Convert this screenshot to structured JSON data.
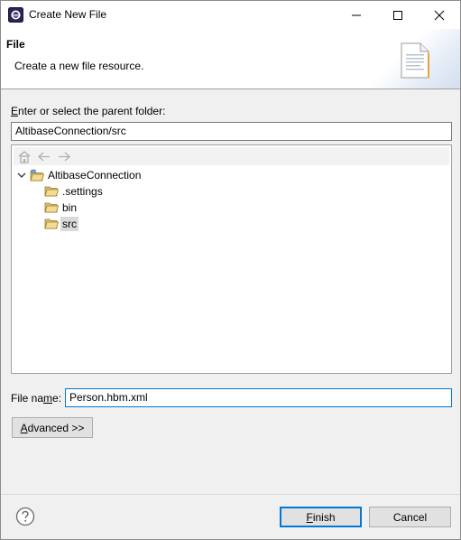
{
  "window": {
    "title": "Create New File"
  },
  "banner": {
    "title": "File",
    "description": "Create a new file resource."
  },
  "parent_folder": {
    "label_prefix": "E",
    "label_rest": "nter or select the parent folder:",
    "value": "AltibaseConnection/src"
  },
  "tree": {
    "project": "AltibaseConnection",
    "children": [
      ".settings",
      "bin",
      "src"
    ],
    "selected": "src"
  },
  "file_name": {
    "label_prefix": "File na",
    "label_mn": "m",
    "label_rest": "e:",
    "value": "Person.hbm.xml"
  },
  "buttons": {
    "advanced_ul": "A",
    "advanced_rest": "dvanced >>",
    "finish_ul": "F",
    "finish_rest": "inish",
    "cancel": "Cancel"
  }
}
